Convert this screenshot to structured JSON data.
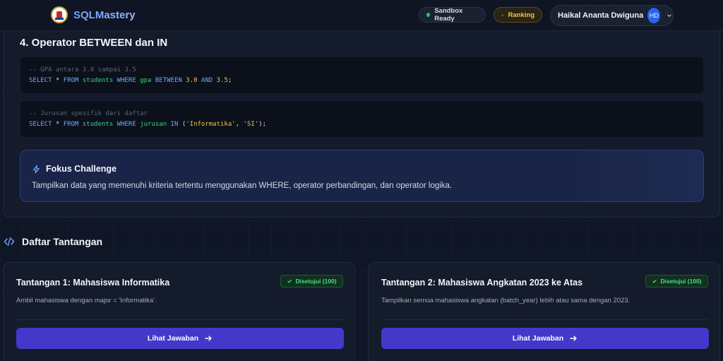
{
  "header": {
    "brand": "SQLMastery",
    "sandbox_status": "Sandbox Ready",
    "ranking_label": "Ranking",
    "user_name": "Haikal Ananta Dwiguna",
    "user_initials": "HD"
  },
  "material": {
    "section_title": "4. Operator BETWEEN dan IN",
    "code_blocks": [
      {
        "comment": "-- GPA antara 3.0 sampai 3.5",
        "tokens": [
          "SELECT",
          "*",
          "FROM",
          "students",
          "WHERE",
          "gpa",
          "BETWEEN",
          "3.0",
          "AND",
          "3.5",
          ";"
        ]
      },
      {
        "comment": "-- Jurusan spesifik dari daftar",
        "tokens": [
          "SELECT",
          "*",
          "FROM",
          "students",
          "WHERE",
          "jurusan",
          "IN",
          "(",
          "'Informatika'",
          ",",
          "'SI'",
          ");"
        ]
      }
    ],
    "focus": {
      "title": "Fokus Challenge",
      "description": "Tampilkan data yang memenuhi kriteria tertentu menggunakan WHERE, operator perbandingan, dan operator logika."
    }
  },
  "challenges": {
    "section_title": "Daftar Tantangan",
    "items": [
      {
        "title": "Tantangan 1: Mahasiswa Informatika",
        "badge": "Disetujui (100)",
        "description": "Ambil mahasiswa dengan major = 'Informatika'.",
        "button": "Lihat Jawaban"
      },
      {
        "title": "Tantangan 2: Mahasiswa Angkatan 2023 ke Atas",
        "badge": "Disetujui (100)",
        "description": "Tampilkan semua mahasiswa angkatan (batch_year) lebih atau sama dengan 2023.",
        "button": "Lihat Jawaban"
      }
    ]
  },
  "colors": {
    "accent": "#4338ca",
    "brand": "#7fa8ff",
    "success": "#4ade80",
    "ranking": "#f2c744",
    "background": "#0f1626"
  },
  "icons": {
    "brand_logo": "university-seal-logo",
    "sandbox": "status-dot-icon",
    "ranking": "bar-chart-icon",
    "user_menu": "chevron-down-icon",
    "focus": "lightning-bolt-icon",
    "list": "code-brackets-icon",
    "badge": "check-icon",
    "button": "arrow-right-icon"
  }
}
